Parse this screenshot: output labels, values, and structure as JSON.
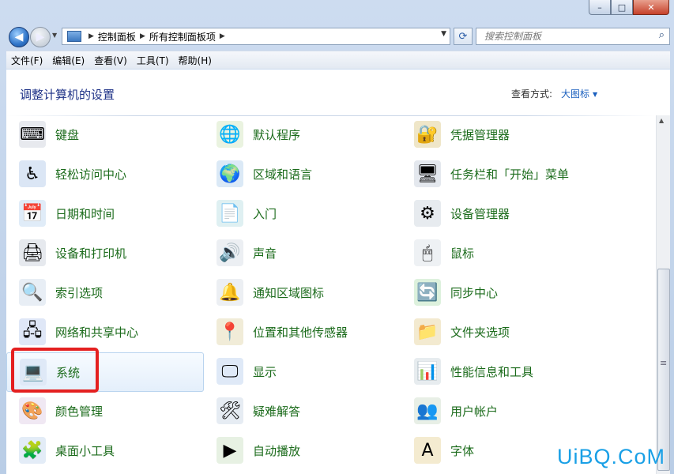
{
  "window": {
    "caption": {
      "minimize": "–",
      "maximize": "□",
      "close": "✕"
    }
  },
  "nav": {
    "back_icon": "back-arrow-icon",
    "forward_icon": "forward-arrow-icon",
    "breadcrumb": [
      "控制面板",
      "所有控制面板项"
    ],
    "search_placeholder": "搜索控制面板"
  },
  "menu": [
    "文件(F)",
    "编辑(E)",
    "查看(V)",
    "工具(T)",
    "帮助(H)"
  ],
  "header": {
    "title": "调整计算机的设置",
    "view_by_label": "查看方式:",
    "view_by_value": "大图标"
  },
  "items": [
    [
      "键盘",
      "默认程序",
      "凭据管理器"
    ],
    [
      "轻松访问中心",
      "区域和语言",
      "任务栏和「开始」菜单"
    ],
    [
      "日期和时间",
      "入门",
      "设备管理器"
    ],
    [
      "设备和打印机",
      "声音",
      "鼠标"
    ],
    [
      "索引选项",
      "通知区域图标",
      "同步中心"
    ],
    [
      "网络和共享中心",
      "位置和其他传感器",
      "文件夹选项"
    ],
    [
      "系统",
      "显示",
      "性能信息和工具"
    ],
    [
      "颜色管理",
      "疑难解答",
      "用户帐户"
    ],
    [
      "桌面小工具",
      "自动播放",
      "字体"
    ]
  ],
  "selected_item": "系统",
  "watermark": "UiBQ.CoM"
}
